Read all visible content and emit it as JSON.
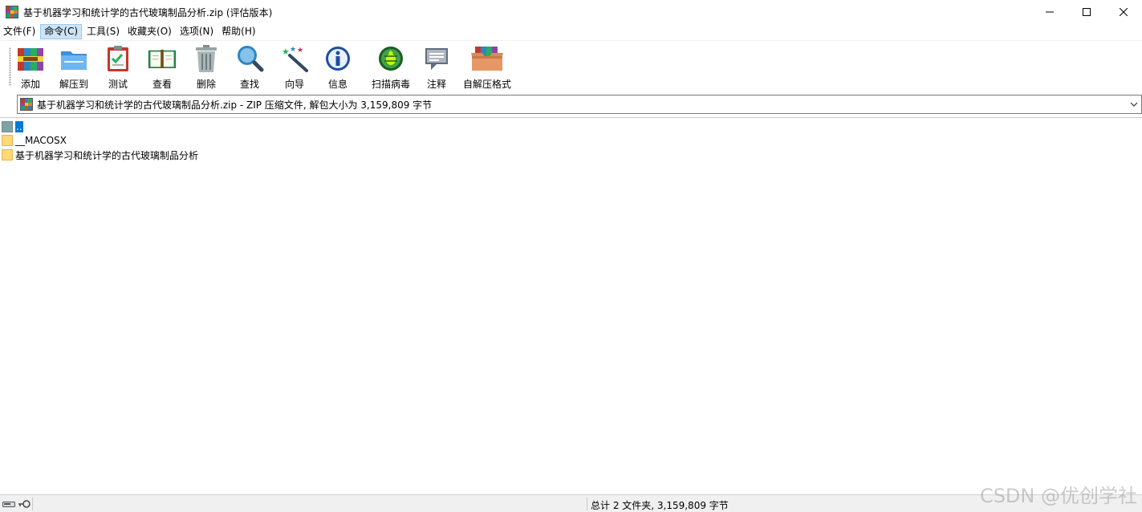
{
  "window": {
    "title": "基于机器学习和统计学的古代玻璃制品分析.zip (评估版本)"
  },
  "menu": [
    {
      "label": "文件(F)"
    },
    {
      "label": "命令(C)"
    },
    {
      "label": "工具(S)"
    },
    {
      "label": "收藏夹(O)"
    },
    {
      "label": "选项(N)"
    },
    {
      "label": "帮助(H)"
    }
  ],
  "toolbar": {
    "add": "添加",
    "extract_to": "解压到",
    "test": "测试",
    "view": "查看",
    "delete": "删除",
    "find": "查找",
    "wizard": "向导",
    "info": "信息",
    "virus_scan": "扫描病毒",
    "comment": "注释",
    "sfx": "自解压格式"
  },
  "address": {
    "text": "基于机器学习和统计学的古代玻璃制品分析.zip - ZIP 压缩文件, 解包大小为 3,159,809 字节"
  },
  "files": [
    {
      "name": ".."
    },
    {
      "name": "__MACOSX"
    },
    {
      "name": "基于机器学习和统计学的古代玻璃制品分析"
    }
  ],
  "status": {
    "summary": "总计 2 文件夹, 3,159,809 字节"
  },
  "watermark": "CSDN @优创学社",
  "colors": {
    "selection": "#0078d7",
    "folder": "#ffd877",
    "menu_active": "#cce4f7"
  }
}
